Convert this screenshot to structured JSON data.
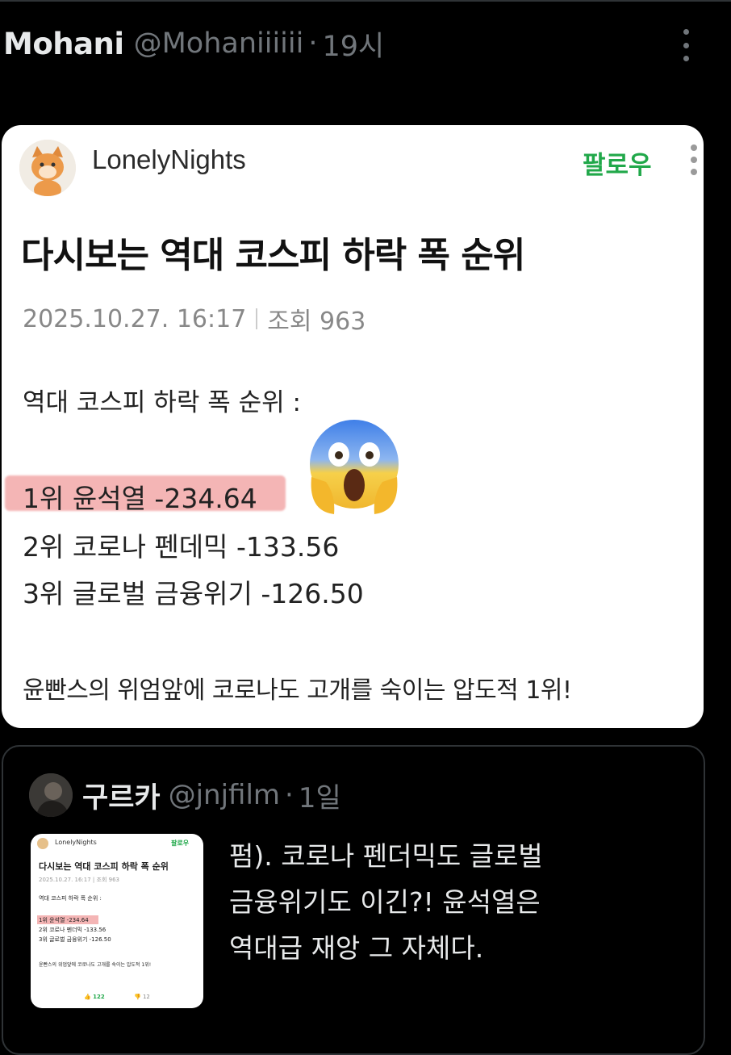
{
  "post": {
    "display_name": "Mohani",
    "handle": "@Mohaniiiiii",
    "separator": "·",
    "time": "19시"
  },
  "embedded_card": {
    "author": "LonelyNights",
    "follow_label": "팔로우",
    "title": "다시보는 역대 코스피 하락 폭 순위",
    "date": "2025.10.27. 16:17",
    "views": "조회 963",
    "subtitle": "역대 코스피 하락 폭 순위 :",
    "rankings": [
      "1위 윤석열 -234.64",
      "2위 코로나 펜데믹 -133.56",
      "3위 글로벌 금융위기 -126.50"
    ],
    "footer": "윤빤스의 위엄앞에 코로나도 고개를 숙이는 압도적 1위!",
    "emoji": "screaming-face"
  },
  "quoted": {
    "display_name": "구르카",
    "handle": "@jnjfilm",
    "separator": "·",
    "time": "1일",
    "text_lines": [
      "펌). 코로나 펜더믹도 글로벌",
      "금융위기도 이긴?! 윤석열은",
      "역대급 재앙 그 자체다."
    ],
    "thumbnail": {
      "author": "LonelyNights",
      "follow_label": "팔로우",
      "title": "다시보는 역대 코스피 하락 폭 순위",
      "meta": "2025.10.27. 16:17 | 조회 963",
      "subtitle": "역대 코스피 하락 폭 순위 :",
      "rankings": [
        "1위 윤석열 -234.64",
        "2위 코로나 펜더믹 -133.56",
        "3위 글로벌 금융위기 -126.50"
      ],
      "footer": "윤빤스의 위엄앞에 코로나도 고개를 숙이는 압도적 1위!",
      "likes": "122",
      "dislikes": "12"
    }
  },
  "colors": {
    "background": "#000000",
    "text_primary": "#e7e9ea",
    "text_secondary": "#71767b",
    "follow_green": "#21a84a",
    "highlight": "#f4b5b5"
  }
}
